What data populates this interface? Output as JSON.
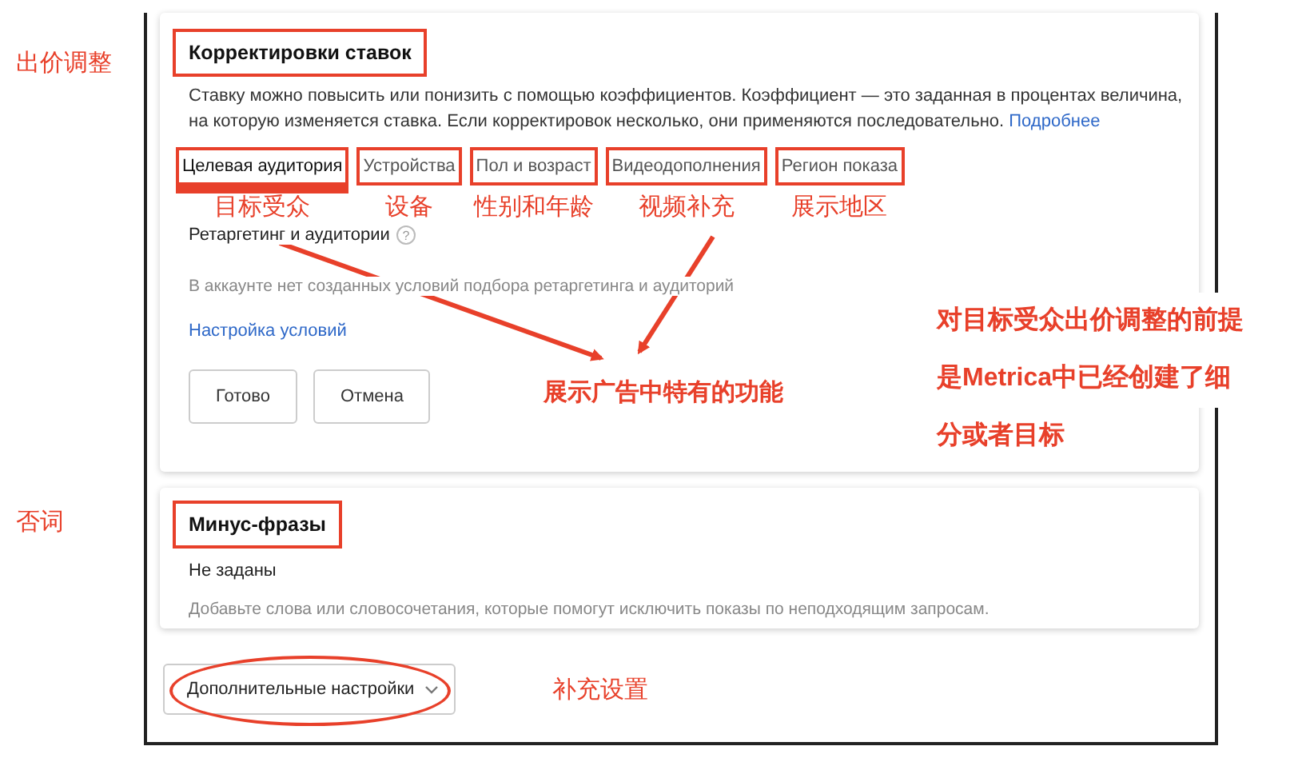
{
  "bid_adjustments": {
    "side_label": "出价调整",
    "title": "Корректировки ставок",
    "description": "Ставку можно повысить или понизить с помощью коэффициентов. Коэффициент — это заданная в процентах величина, на которую изменяется ставка. Если корректировок несколько, они применяются последовательно.",
    "more_link": "Подробнее",
    "tabs": [
      {
        "label": "Целевая аудитория",
        "note": "目标受众",
        "selected": true
      },
      {
        "label": "Устройства",
        "note": "设备",
        "selected": false
      },
      {
        "label": "Пол и возраст",
        "note": "性别和年龄",
        "selected": false
      },
      {
        "label": "Видеодополнения",
        "note": "视频补充",
        "selected": false
      },
      {
        "label": "Регион показа",
        "note": "展示地区",
        "selected": false
      }
    ],
    "retargeting": {
      "label": "Ретаргетинг и аудитории",
      "help": "?",
      "empty_text": "В аккаунте нет созданных условий подбора ретаргетинга и аудиторий",
      "link": "Настройка условий"
    },
    "buttons": [
      "Готово",
      "Отмена"
    ],
    "arrow_note": "展示广告中特有的功能",
    "side_note": [
      "对目标受众出价调整的前提",
      "是Metrica中已经创建了细",
      "分或者目标"
    ]
  },
  "minus_phrases": {
    "side_label": "否词",
    "title": "Минус-фразы",
    "status": "Не заданы",
    "hint": "Добавьте слова или словосочетания, которые помогут исключить показы по неподходящим запросам."
  },
  "more_settings": {
    "label": "Дополнительные настройки",
    "note": "补充设置"
  }
}
